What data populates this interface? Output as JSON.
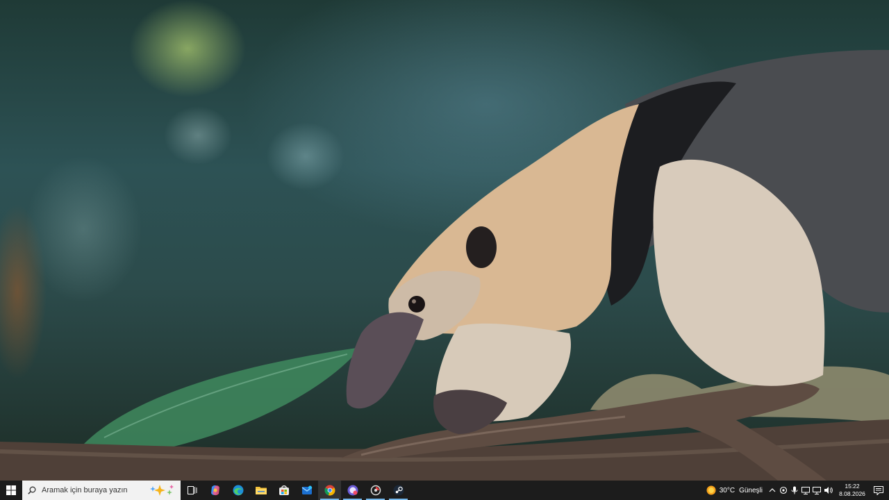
{
  "desktop": {
    "wallpaper": "anteater-on-branch"
  },
  "taskbar": {
    "start_icon": "windows-logo-icon",
    "search": {
      "placeholder": "Aramak için buraya yazın"
    },
    "apps": [
      {
        "name": "task-view",
        "icon": "task-view-icon"
      },
      {
        "name": "copilot",
        "icon": "copilot-icon"
      },
      {
        "name": "edge",
        "icon": "edge-icon"
      },
      {
        "name": "file-explorer",
        "icon": "folder-icon"
      },
      {
        "name": "microsoft-store",
        "icon": "store-icon"
      },
      {
        "name": "mail",
        "icon": "mail-icon"
      },
      {
        "name": "chrome",
        "icon": "chrome-icon",
        "active": true
      },
      {
        "name": "discord-like",
        "icon": "chat-app-icon"
      },
      {
        "name": "recorder",
        "icon": "record-icon"
      },
      {
        "name": "steam",
        "icon": "steam-icon"
      }
    ],
    "weather": {
      "temperature": "30°C",
      "condition": "Güneşli"
    },
    "clock": {
      "time": "15:22",
      "date": "8.08.2026"
    }
  },
  "colors": {
    "taskbar_bg": "#1c1c1c",
    "active_indicator": "#76b9ed"
  }
}
